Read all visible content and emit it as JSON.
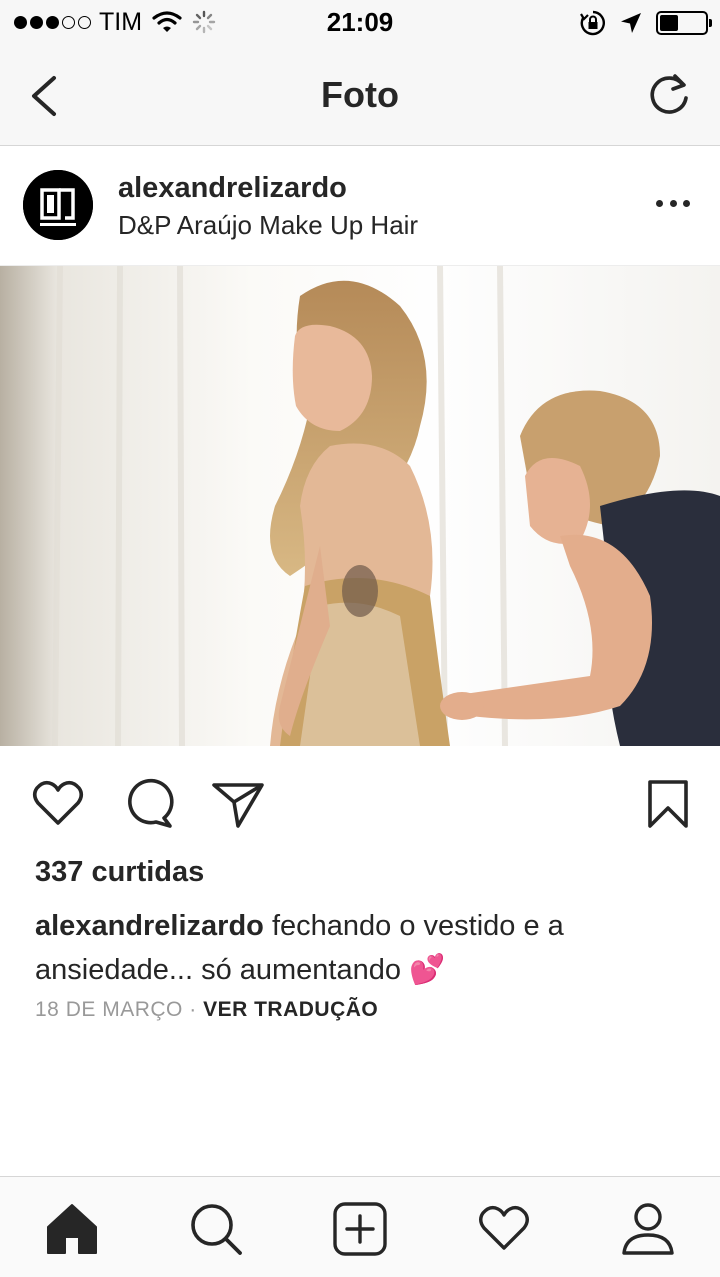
{
  "status_bar": {
    "carrier": "TIM",
    "time": "21:09",
    "signal_bars_filled": 3,
    "signal_bars_total": 5,
    "battery_level": 0.4,
    "icons": [
      "signal-icon",
      "wifi-icon",
      "activity-spinner-icon",
      "orientation-lock-icon",
      "location-arrow-icon",
      "battery-icon"
    ]
  },
  "nav": {
    "title": "Foto",
    "back_icon": "chevron-left-icon",
    "refresh_icon": "refresh-icon"
  },
  "post": {
    "username": "alexandrelizardo",
    "location": "D&P Araújo Make Up Hair",
    "avatar_logo_text": "LIZARDO",
    "likes": "337 curtidas",
    "caption_user": "alexandrelizardo",
    "caption_text": "fechando o vestido e a ansiedade... só aumentando 💕",
    "date": "18 DE MARÇO",
    "separator": "·",
    "translate_label": "VER TRADUÇÃO"
  },
  "actions": {
    "icons": [
      "heart-icon",
      "comment-icon",
      "share-icon",
      "bookmark-icon"
    ]
  },
  "tab_bar": {
    "icons": [
      "home-icon",
      "search-icon",
      "add-post-icon",
      "activity-heart-icon",
      "profile-icon"
    ],
    "active": "home-icon"
  },
  "colors": {
    "text": "#262626",
    "muted": "#999999",
    "bar_background": "#f7f7f7"
  }
}
